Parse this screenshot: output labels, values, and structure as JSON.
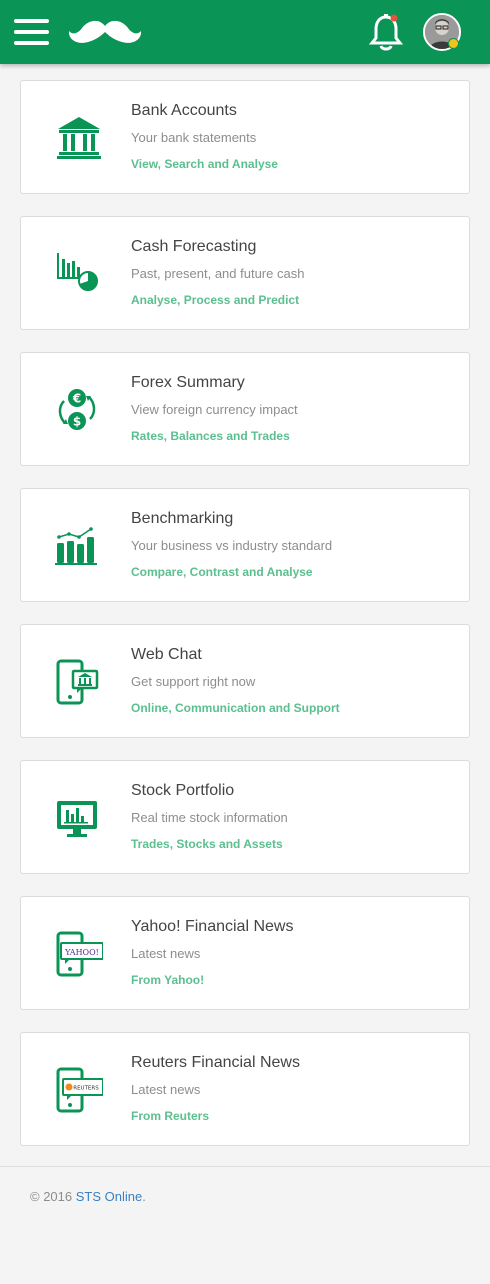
{
  "header": {
    "menu_icon": "hamburger-menu-icon",
    "logo_icon": "mustache-logo-icon",
    "notification_icon": "bell-icon",
    "avatar_icon": "user-avatar",
    "brand_color": "#0a9455"
  },
  "cards": [
    {
      "title": "Bank Accounts",
      "desc": "Your bank statements",
      "link": "View, Search and Analyse",
      "icon": "bank-icon"
    },
    {
      "title": "Cash Forecasting",
      "desc": "Past, present, and future cash",
      "link": "Analyse, Process and Predict",
      "icon": "forecast-chart-icon"
    },
    {
      "title": "Forex Summary",
      "desc": "View foreign currency impact",
      "link": "Rates, Balances and Trades",
      "icon": "currency-exchange-icon"
    },
    {
      "title": "Benchmarking",
      "desc": "Your business vs industry standard",
      "link": "Compare, Contrast and Analyse",
      "icon": "benchmark-chart-icon"
    },
    {
      "title": "Web Chat",
      "desc": "Get support right now",
      "link": "Online, Communication and Support",
      "icon": "mobile-chat-icon"
    },
    {
      "title": "Stock Portfolio",
      "desc": "Real time stock information",
      "link": "Trades, Stocks and Assets",
      "icon": "monitor-chart-icon"
    },
    {
      "title": "Yahoo! Financial News",
      "desc": "Latest news",
      "link": "From Yahoo!",
      "icon": "yahoo-news-icon",
      "icon_text": "YAHOO!"
    },
    {
      "title": "Reuters Financial News",
      "desc": "Latest news",
      "link": "From Reuters",
      "icon": "reuters-news-icon",
      "icon_text": "REUTERS"
    }
  ],
  "footer": {
    "prefix": "© 2016 ",
    "link": "STS Online",
    "suffix": "."
  }
}
